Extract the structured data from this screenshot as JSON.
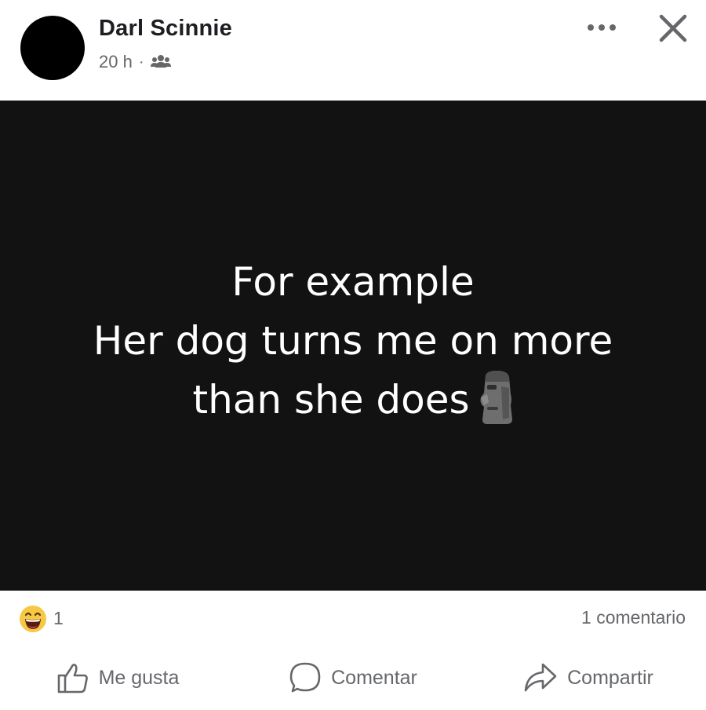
{
  "post": {
    "author": "Darl Scinnie",
    "time": "20 h",
    "separator": "·",
    "audience_icon": "group-icon",
    "text_lines": [
      "For example",
      "Her dog turns me on more",
      "than she does"
    ],
    "emoji_icon": "moai-icon"
  },
  "stats": {
    "reaction_icon": "haha-reaction-icon",
    "reaction_count": "1",
    "comment_count": "1 comentario"
  },
  "actions": {
    "like_label": "Me gusta",
    "comment_label": "Comentar",
    "share_label": "Compartir"
  },
  "colors": {
    "image_background": "#121212",
    "muted_text": "#65676b",
    "author_text": "#1c1e21",
    "haha_yellow": "#f7c844"
  }
}
